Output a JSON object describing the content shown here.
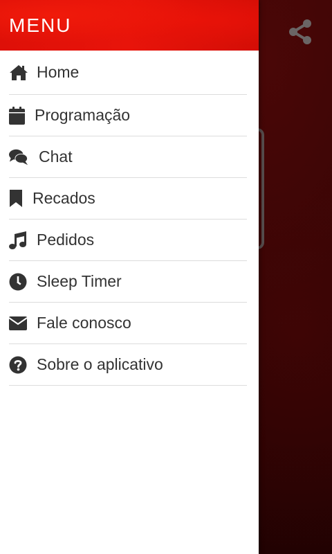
{
  "drawer": {
    "title": "MENU",
    "items": [
      {
        "label": "Home",
        "icon": "home-icon"
      },
      {
        "label": "Programação",
        "icon": "calendar-icon"
      },
      {
        "label": "Chat",
        "icon": "chat-bubbles-icon"
      },
      {
        "label": "Recados",
        "icon": "bookmark-icon"
      },
      {
        "label": "Pedidos",
        "icon": "music-note-icon"
      },
      {
        "label": "Sleep Timer",
        "icon": "clock-icon"
      },
      {
        "label": "Fale conosco",
        "icon": "envelope-icon"
      },
      {
        "label": "Sobre o aplicativo",
        "icon": "question-circle-icon"
      }
    ]
  },
  "app": {
    "share_icon": "share-icon"
  },
  "colors": {
    "header_red": "#e8140a",
    "text_dark": "#333333",
    "background_dark_red": "#2a0303",
    "divider": "#dcdcdc"
  }
}
